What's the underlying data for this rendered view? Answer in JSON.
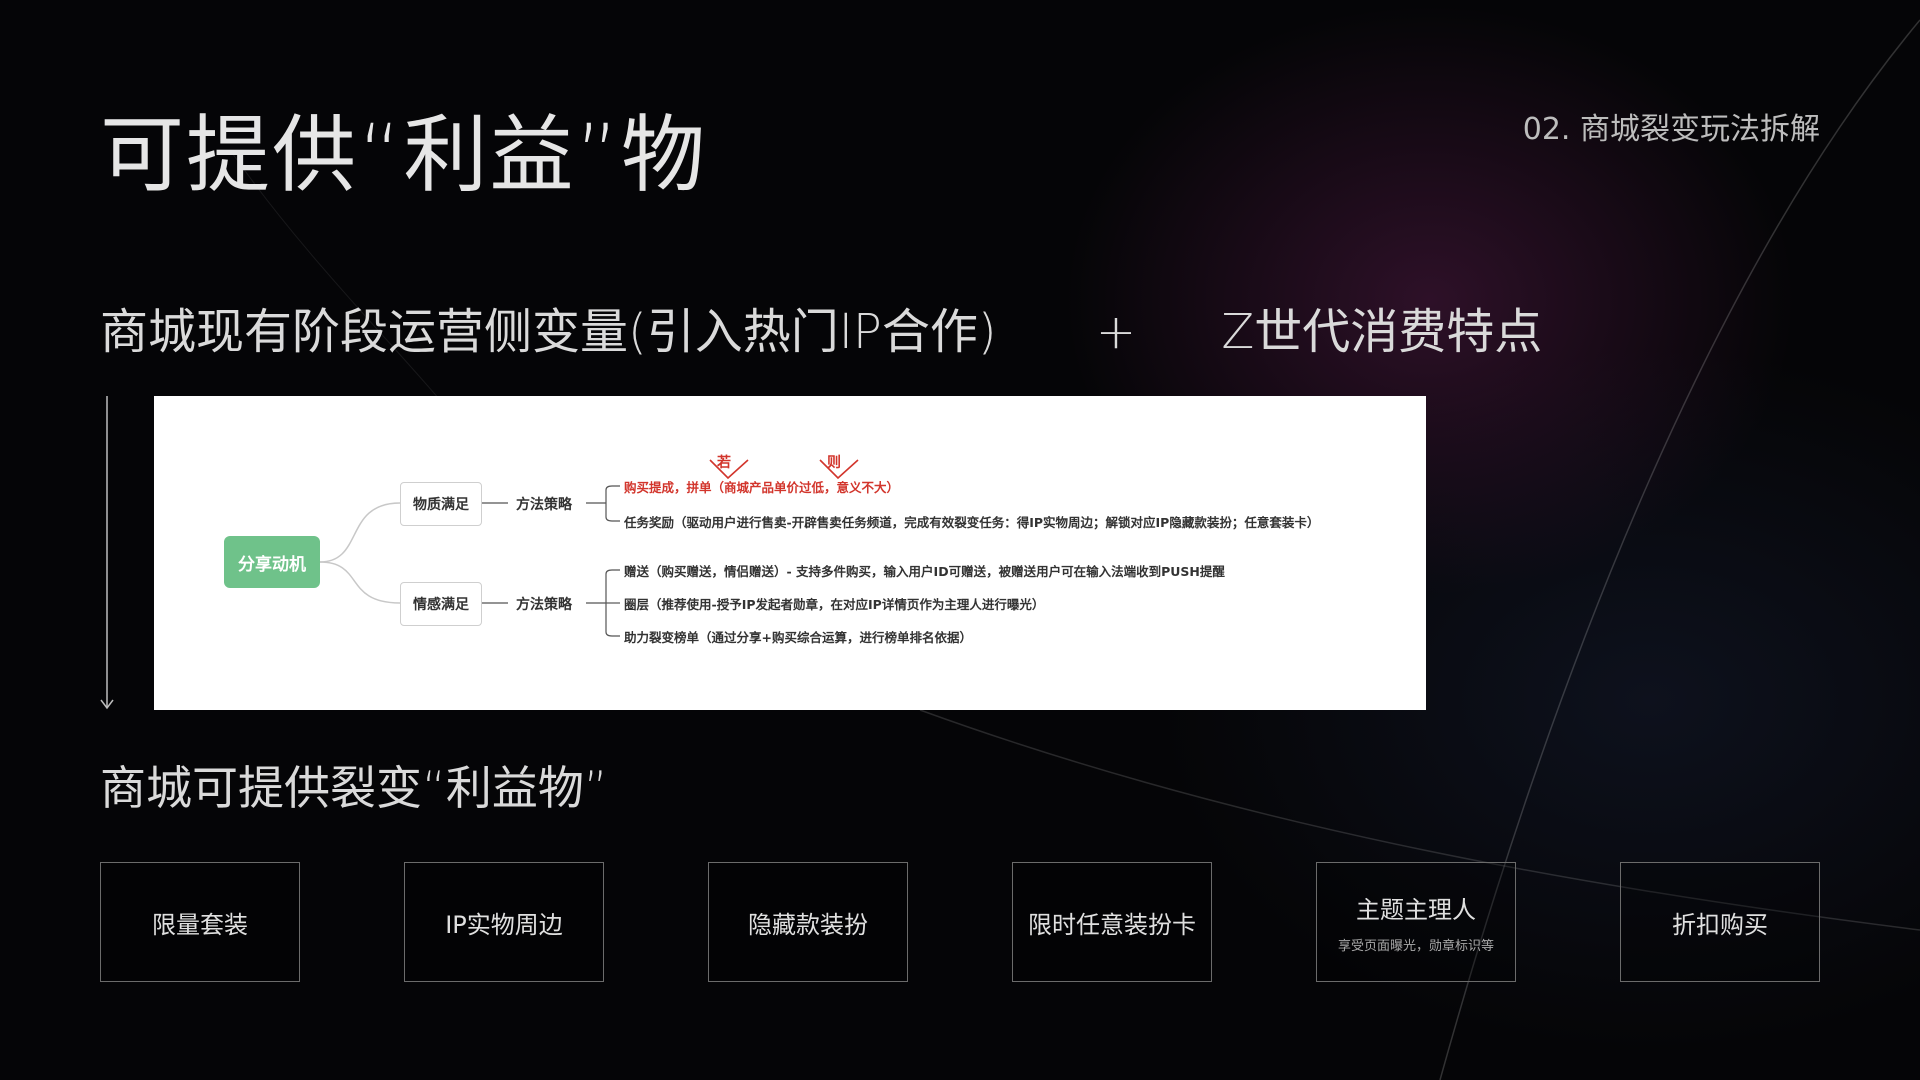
{
  "slide": {
    "title": "可提供“利益”物",
    "section_tag": "02. 商城裂变玩法拆解"
  },
  "formula": {
    "left": "商城现有阶段运营侧变量(引入热门IP合作)",
    "operator": "+",
    "right": "Z世代消费特点"
  },
  "mindmap": {
    "root": "分享动机",
    "branches": [
      {
        "label": "物质满足",
        "strategy": "方法策略",
        "leaves": [
          "购买提成，拼单（商城产品单价过低，意义不大）",
          "任务奖励（驱动用户进行售卖-开辟售卖任务频道，完成有效裂变任务：得IP实物周边；解锁对应IP隐藏款装扮；任意套装卡）"
        ]
      },
      {
        "label": "情感满足",
        "strategy": "方法策略",
        "leaves": [
          "赠送（购买赠送，情侣赠送）- 支持多件购买，输入用户ID可赠送，被赠送用户可在输入法端收到PUSH提醒",
          "圈层（推荐使用-授予IP发起者勋章，在对应IP详情页作为主理人进行曝光）",
          "助力裂变榜单（通过分享+购买综合运算，进行榜单排名依据）"
        ]
      }
    ],
    "annotations": [
      "若",
      "则"
    ]
  },
  "subtitle": "商城可提供裂变“利益物”",
  "cards": [
    {
      "title": "限量套装",
      "sub": ""
    },
    {
      "title": "IP实物周边",
      "sub": ""
    },
    {
      "title": "隐藏款装扮",
      "sub": ""
    },
    {
      "title": "限时任意装扮卡",
      "sub": ""
    },
    {
      "title": "主题主理人",
      "sub": "享受页面曝光，勋章标识等"
    },
    {
      "title": "折扣购买",
      "sub": ""
    }
  ],
  "colors": {
    "background": "#050507",
    "root_node": "#6fc28a",
    "highlight_red": "#d2352c",
    "card_border": "#6b6b6b"
  }
}
